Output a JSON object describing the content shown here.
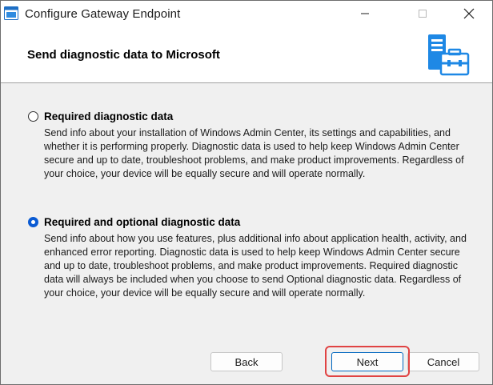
{
  "window": {
    "title": "Configure Gateway Endpoint",
    "controls": {
      "minimize": "minimize",
      "maximize": "maximize",
      "close": "close"
    }
  },
  "header": {
    "title": "Send diagnostic data to Microsoft",
    "icon": "server-gateway-icon"
  },
  "options": [
    {
      "label": "Required diagnostic data",
      "selected": false,
      "description": "Send info about your installation of Windows Admin Center, its settings and capabilities, and whether it is performing properly. Diagnostic data is used to help keep Windows Admin Center secure and up to date, troubleshoot problems, and make product improvements. Regardless of your choice, your device will be equally secure and will operate normally."
    },
    {
      "label": "Required and optional diagnostic data",
      "selected": true,
      "description": "Send info about how you use features, plus additional info about application health, activity, and enhanced error reporting. Diagnostic data is used to help keep Windows Admin Center secure and up to date, troubleshoot problems, and make product improvements. Required diagnostic data will always be included when you choose to send Optional diagnostic data. Regardless of your choice, your device will be equally secure and will operate normally."
    }
  ],
  "buttons": {
    "back": "Back",
    "next": "Next",
    "cancel": "Cancel"
  },
  "colors": {
    "accent": "#0a5bd3",
    "highlight": "#e04343",
    "icon_blue": "#1e88e5"
  }
}
